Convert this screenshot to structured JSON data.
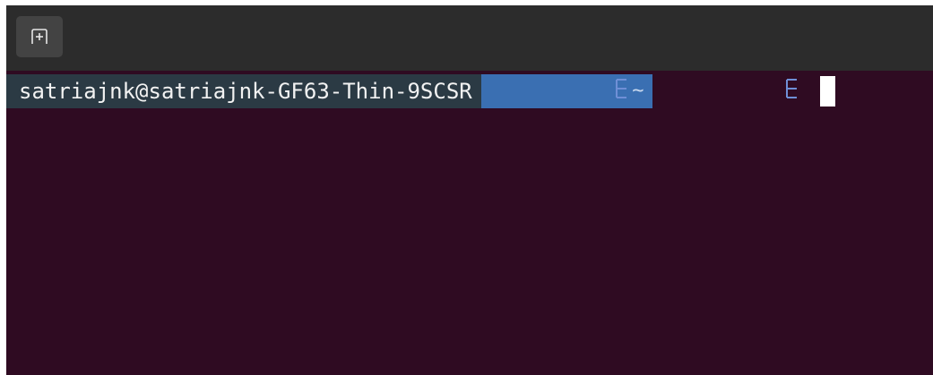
{
  "headerbar": {
    "new_tab_button": {
      "icon": "new-tab-icon"
    }
  },
  "terminal": {
    "prompt": {
      "user_host": "satriajnk@satriajnk-GF63-Thin-9SCSR",
      "directory": "~",
      "separator_icon": "powerline-separator-icon"
    }
  },
  "colors": {
    "terminal_background": "#2f0b22",
    "headerbar_background": "#2c2c2c",
    "button_background": "#434343",
    "user_segment_background": "#2b3a44",
    "dir_segment_background": "#3a6fb2",
    "separator_color": "#6f8fd6"
  }
}
